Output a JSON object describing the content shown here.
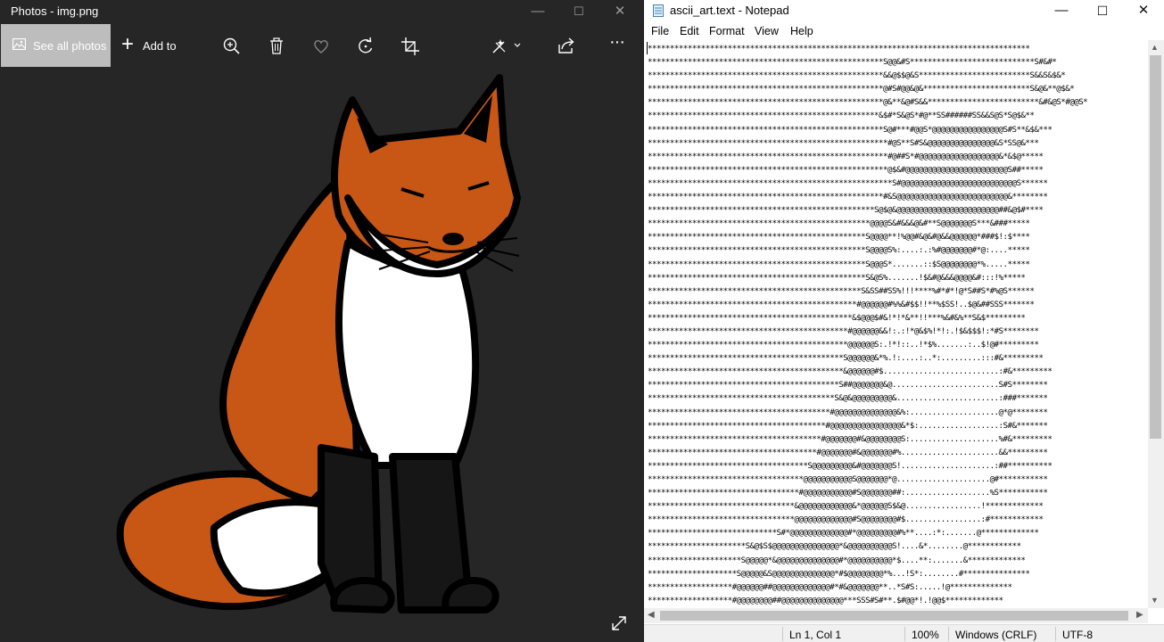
{
  "photos": {
    "title": "Photos - img.png",
    "see_all_label": "See all photos",
    "add_to_label": "Add to",
    "toolbar_icons": [
      "zoom-in-icon",
      "delete-icon",
      "heart-icon",
      "rotate-icon",
      "crop-icon",
      "edit-icon",
      "share-icon",
      "more-icon"
    ],
    "more_label": "···",
    "window_controls": {
      "minimize": "—",
      "maximize": "☐",
      "close": "✕"
    }
  },
  "notepad": {
    "title": "ascii_art.text - Notepad",
    "menu": {
      "file": "File",
      "edit": "Edit",
      "format": "Format",
      "view": "View",
      "help": "Help"
    },
    "window_controls": {
      "minimize": "—",
      "maximize": "☐",
      "close": "✕"
    },
    "content": "**************************************************************************************\n*****************************************************S@@&#S****************************S#&#*\n*****************************************************&&@$$@&S*************************S&&S&$&*\n*****************************************************@#S#@@&@&************************S&@&**@$&*\n*****************************************************@&**&@#S&&*************************&#&@S*#@@S*\n****************************************************&$#*S&@S*#@**SS######SS&&S@S*S@$&**\n*****************************************************S@#***#@@S*@@@@@@@@@@@@@@@@S#S**&$&***\n******************************************************#@S**S#S&@@@@@@@@@@@@@@@&S*SS@&***\n******************************************************#@##S*#@@@@@@@@@@@@@@@@@@&*&$@*****\n******************************************************@$&#@@@@@@@@@@@@@@@@@@@@@@@S##*****\n*******************************************************S#@@@@@@@@@@@@@@@@@@@@@@@@@@S******\n*****************************************************#&S@@@@@@@@@@@@@@@@@@@@@@@@@&********\n***************************************************S@$@&@@@@@@@@@@@@@@@@@@@@@@@##&@$#****\n**************************************************@@@@S&#&&&@&#**S@@@@@@@S***&###*****\n*************************************************S@@@@**!%@@#&@&#@&&@@@@@@*###$!:$****\n*************************************************S@@@@S%:....:.:%#@@@@@@@#*@:....*****\n*************************************************S@@@S*.......::$S@@@@@@@@*%.....*****\n*************************************************S&@S%.......!$&#@&&&@@@@&#:::!%*****\n************************************************S&SS##SS%!!!****%#*#*!@*S##S*#%@S******\n***********************************************#@@@@@@#%%&#$$!!**%$SS!..$@&##SSS*******\n**********************************************&$@@@$#&!*!*&**!!***%&#&%**S&$*********\n*********************************************#@@@@@@&&!:.:!*@&$%!*!:.!$&$$$!:*#S********\n*********************************************@@@@@@S:.!*!::..!*$%.......:..$!@#*********\n********************************************S@@@@@@&*%.!:....:..*:.........:::#&*********\n********************************************&@@@@@@#$..........................:#&*********\n*******************************************S##@@@@@@@&@........................S#S********\n******************************************S&@&@@@@@@@@@&.......................:###*******\n*****************************************#@@@@@@@@@@@@@@&%:....................@*@********\n****************************************#@@@@@@@@@@@@@@@@&*$:..................:S#&*******\n***************************************#@@@@@@@#&@@@@@@@@S:....................%#&*********\n**************************************#@@@@@@@#&@@@@@@@#%......................&&*********\n************************************S@@@@@@@@@&#@@@@@@@S!.....................:##**********\n***********************************@@@@@@@@@@@S@@@@@@@*@.....................@#***********\n**********************************#@@@@@@@@@@@#S@@@@@@@##:...................%S***********\n*********************************&@@@@@@@@@@@@&*@@@@@@S$&@.................!*************\n*********************************@@@@@@@@@@@@@#S@@@@@@@@#$.................:#************\n*****************************S#*@@@@@@@@@@@@@#*@@@@@@@@@#%**....:*:.......@*************\n**********************S&@$S$@@@@@@@@@@@@@@@*&@@@@@@@@@@S!....&*........@************\n*********************S@@@@@*&@@@@@@@@@@@@@@#*@@@@@@@@@@*$....**:.......&*************\n********************S@@@@@&S@@@@@@@@@@@@@@*#$@@@@@@@@*%...!S*:........#***************\n*******************#@@@@@@##@@@@@@@@@@@@@#*#&@@@@@@@**..*S#S:.....!@**************\n*******************#@@@@@@@@##@@@@@@@@@@@@@@***SSS#S#**.$#@@*!.!@@$*************\n***************************************************************************************",
    "status": {
      "position": "Ln 1, Col 1",
      "zoom": "100%",
      "line_ending": "Windows (CRLF)",
      "encoding": "UTF-8"
    }
  }
}
